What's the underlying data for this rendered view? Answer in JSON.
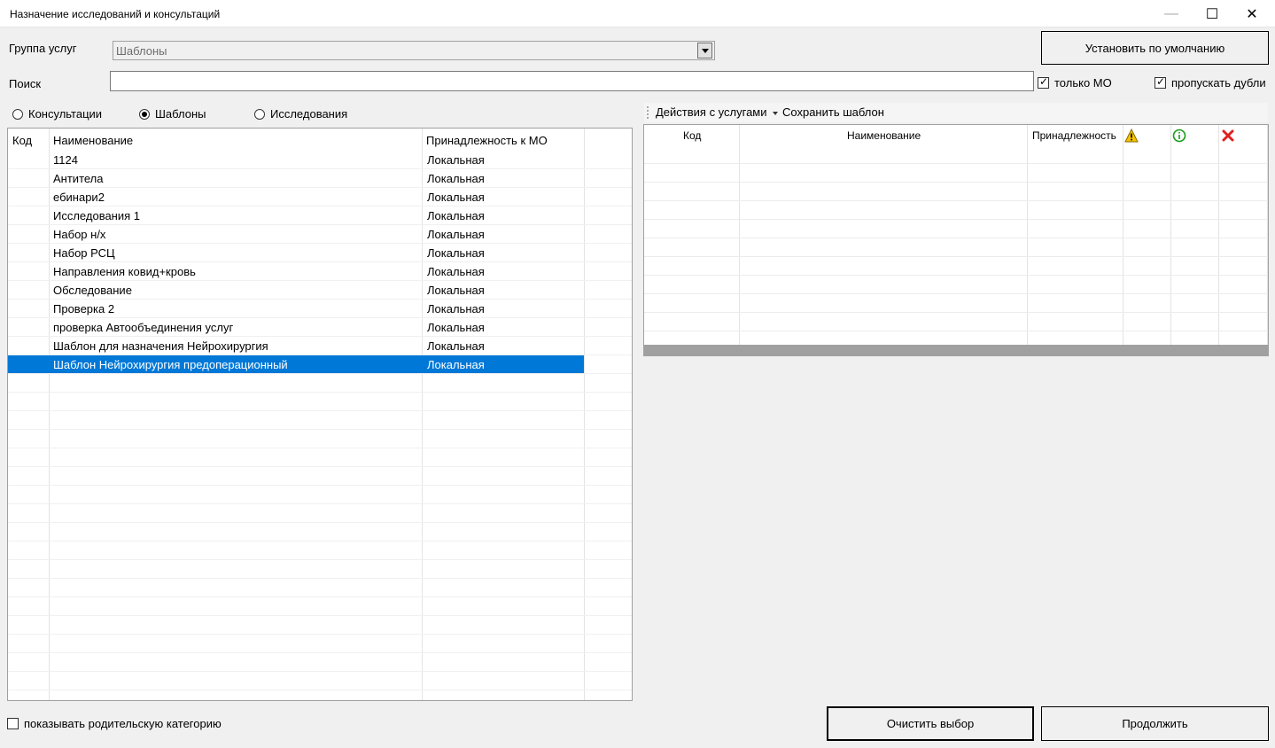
{
  "window": {
    "title": "Назначение исследований и консультаций",
    "minimize_glyph": "—",
    "maximize_glyph": "☐",
    "close_glyph": "✕"
  },
  "service_group": {
    "label": "Группа услуг",
    "value": "Шаблоны"
  },
  "search": {
    "label": "Поиск",
    "value": ""
  },
  "buttons": {
    "set_default": "Установить по умолчанию",
    "clear_selection": "Очистить выбор",
    "continue": "Продолжить"
  },
  "checkboxes": {
    "only_mo": {
      "label": "только МО",
      "checked": true
    },
    "skip_duplicates": {
      "label": "пропускать дубли",
      "checked": true
    },
    "show_parent": {
      "label": "показывать родительскую категорию",
      "checked": false
    }
  },
  "radios": [
    {
      "label": "Консультации",
      "selected": false
    },
    {
      "label": "Шаблоны",
      "selected": true
    },
    {
      "label": "Исследования",
      "selected": false
    }
  ],
  "left_grid": {
    "headers": [
      "Код",
      "Наименование",
      "Принадлежность к МО"
    ],
    "rows": [
      {
        "code": "",
        "name": "1124",
        "owner": "Локальная"
      },
      {
        "code": "",
        "name": "Антитела",
        "owner": "Локальная"
      },
      {
        "code": "",
        "name": "ебинари2",
        "owner": "Локальная"
      },
      {
        "code": "",
        "name": "Исследования 1",
        "owner": "Локальная"
      },
      {
        "code": "",
        "name": "Набор н/х",
        "owner": "Локальная"
      },
      {
        "code": "",
        "name": "Набор РСЦ",
        "owner": "Локальная"
      },
      {
        "code": "",
        "name": "Направления ковид+кровь",
        "owner": "Локальная"
      },
      {
        "code": "",
        "name": "Обследование",
        "owner": "Локальная"
      },
      {
        "code": "",
        "name": "Проверка 2",
        "owner": "Локальная"
      },
      {
        "code": "",
        "name": "проверка Автообъединения услуг",
        "owner": "Локальная"
      },
      {
        "code": "",
        "name": "Шаблон для назначения Нейрохирургия",
        "owner": "Локальная"
      },
      {
        "code": "",
        "name": "Шаблон Нейрохирургия предоперационный",
        "owner": "Локальная",
        "selected": true
      }
    ]
  },
  "right_toolbar": {
    "actions_menu": "Действия с услугами",
    "save_template": "Сохранить шаблон"
  },
  "right_grid": {
    "headers": [
      "Код",
      "Наименование",
      "Принадлежность"
    ],
    "icons": [
      "warning-icon",
      "info-icon",
      "delete-icon"
    ]
  },
  "colors": {
    "selection": "#0078d7",
    "warning": "#f5c400",
    "info": "#1a9b1a",
    "delete": "#e02020"
  }
}
